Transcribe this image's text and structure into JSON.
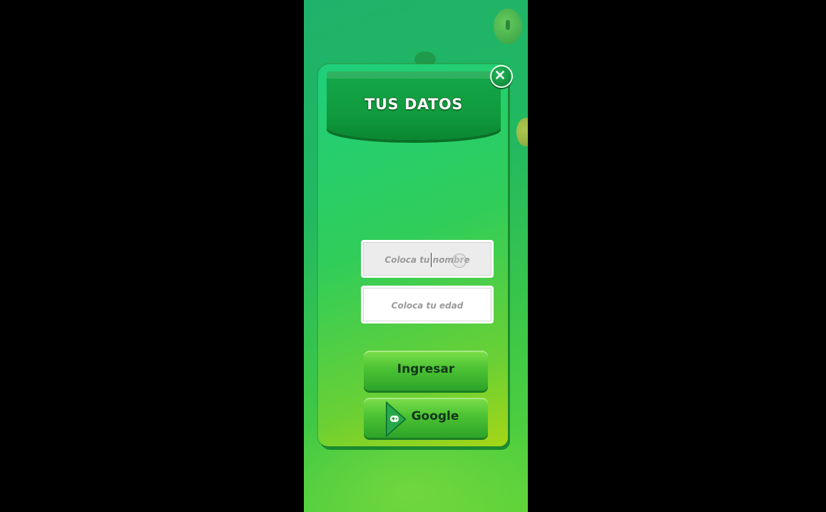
{
  "dialog": {
    "title": "TUS DATOS",
    "close_icon": "close-x-icon"
  },
  "form": {
    "name_placeholder": "Coloca tu nombre",
    "age_placeholder": "Coloca tu edad"
  },
  "buttons": {
    "ingresar_label": "Ingresar",
    "google_label": "Google",
    "google_icon": "google-play-games-icon"
  },
  "colors": {
    "background": "#22b862",
    "header": "#0f9a3d",
    "button": "#4cc234",
    "button_text": "#12361a"
  }
}
